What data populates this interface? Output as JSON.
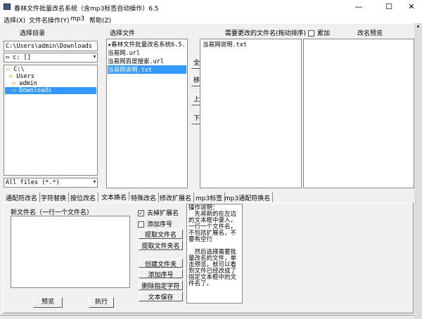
{
  "window": {
    "title": "春林文件批量改名系统（含mp3标签自动操作）6.5",
    "minimize": "—",
    "maximize": "☐",
    "close": "✕"
  },
  "menu": [
    "选择(X)",
    "文件名操作(Y)",
    "mp3",
    "帮助(Z)"
  ],
  "headers": {
    "dir": "选择目录",
    "files": "选择文件",
    "targets": "需要更改的文件名(拖动排序)",
    "accumulate": "累加",
    "preview": "改名预览"
  },
  "path": "C:\\Users\\admin\\Downloads",
  "drive": "c: []",
  "tree": [
    "C:\\",
    "Users",
    "admin",
    "Downloads"
  ],
  "filter": "All files (*.*)",
  "files": [
    "★春林文件批量改名系统6.5.",
    "当易网.url",
    "当易网百度搜索.url",
    "当易网说明.txt"
  ],
  "targets": [
    "当易网说明.txt"
  ],
  "side_buttons": [
    "全选",
    "移出",
    "上移",
    "下移"
  ],
  "tabs": [
    "通配符改名",
    "字符替换",
    "按位改名",
    "文本换名",
    "特殊改名",
    "修改扩展名",
    "mp3标签",
    "mp3通配符换名"
  ],
  "text_tab": {
    "new_names_label": "新文件名（一行一个文件名）",
    "remove_ext": "去掉扩展名",
    "add_seq": "添加序号",
    "buttons": [
      "提取文件名",
      "提取文件夹名",
      "创建文件夹",
      "添加序号",
      "删除指定字符",
      "文本保存"
    ],
    "help": "操作说明：\n　先将新的在左边的文本框中录入，一行一个文件名，不包括扩展名，不要有空行\n\n　然后选择需要批量改名的文件，单击预览，就可以看到文件已经改成了指定文本框中的文件名了。",
    "preview": "预览",
    "execute": "执行"
  }
}
